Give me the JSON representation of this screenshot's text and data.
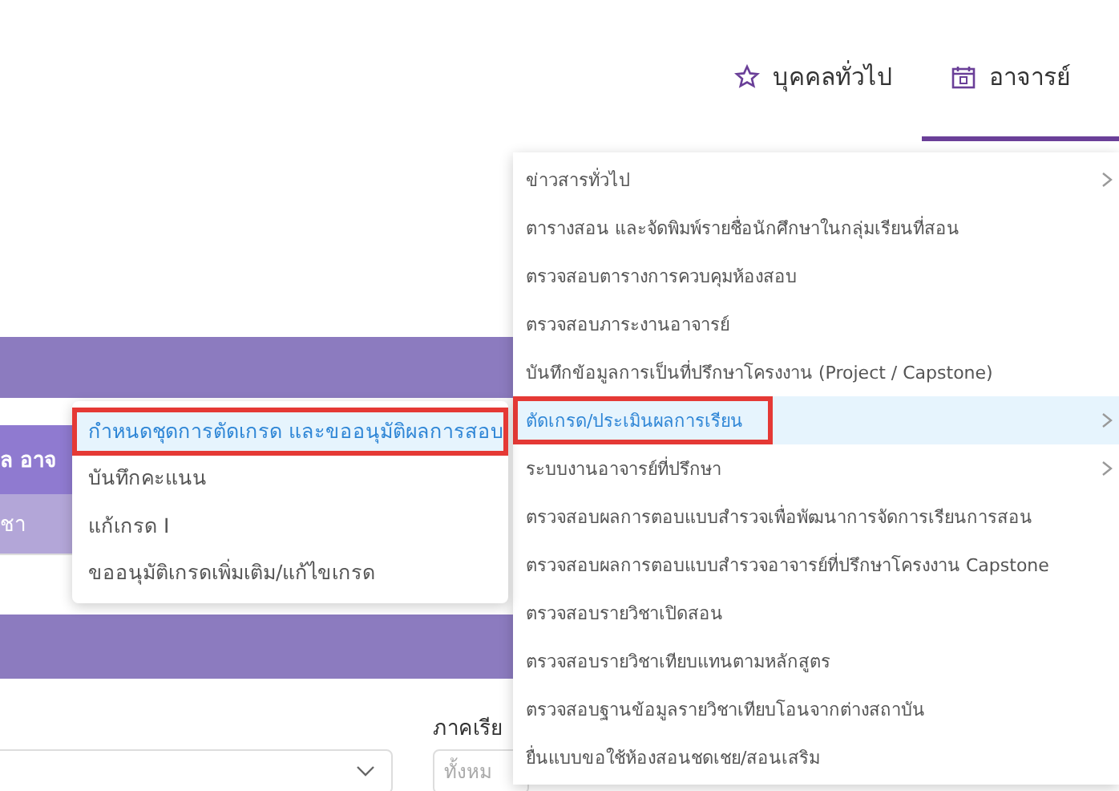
{
  "nav_tabs": [
    {
      "label": "บุคคลทั่วไป",
      "selected": false
    },
    {
      "label": "อาจารย์",
      "selected": true
    }
  ],
  "background": {
    "table_header": "ล อาจ",
    "table_row": "ชา",
    "filter_label": "ภาคเรีย",
    "filter_placeholder": "ทั้งหม"
  },
  "menu": {
    "items": [
      {
        "label": "ข่าวสารทั่วไป",
        "has_submenu": true,
        "selected": false,
        "highlighted": false
      },
      {
        "label": "ตารางสอน และจัดพิมพ์รายชื่อนักศึกษาในกลุ่มเรียนที่สอน",
        "has_submenu": false,
        "selected": false,
        "highlighted": false
      },
      {
        "label": "ตรวจสอบตารางการควบคุมห้องสอบ",
        "has_submenu": false,
        "selected": false,
        "highlighted": false
      },
      {
        "label": "ตรวจสอบภาระงานอาจารย์",
        "has_submenu": false,
        "selected": false,
        "highlighted": false
      },
      {
        "label": "บันทึกข้อมูลการเป็นที่ปรึกษาโครงงาน (Project / Capstone)",
        "has_submenu": false,
        "selected": false,
        "highlighted": false
      },
      {
        "label": "ตัดเกรด/ประเมินผลการเรียน",
        "has_submenu": true,
        "selected": true,
        "highlighted": true
      },
      {
        "label": "ระบบงานอาจารย์ที่ปรึกษา",
        "has_submenu": true,
        "selected": false,
        "highlighted": false
      },
      {
        "label": "ตรวจสอบผลการตอบแบบสำรวจเพื่อพัฒนาการจัดการเรียนการสอน",
        "has_submenu": false,
        "selected": false,
        "highlighted": false
      },
      {
        "label": "ตรวจสอบผลการตอบแบบสำรวจอาจารย์ที่ปรึกษาโครงงาน Capstone",
        "has_submenu": false,
        "selected": false,
        "highlighted": false
      },
      {
        "label": "ตรวจสอบรายวิชาเปิดสอน",
        "has_submenu": false,
        "selected": false,
        "highlighted": false
      },
      {
        "label": "ตรวจสอบรายวิชาเทียบแทนตามหลักสูตร",
        "has_submenu": false,
        "selected": false,
        "highlighted": false
      },
      {
        "label": "ตรวจสอบฐานข้อมูลรายวิชาเทียบโอนจากต่างสถาบัน",
        "has_submenu": false,
        "selected": false,
        "highlighted": false
      },
      {
        "label": "ยื่นแบบขอใช้ห้องสอนชดเชย/สอนเสริม",
        "has_submenu": false,
        "selected": false,
        "highlighted": false
      }
    ]
  },
  "submenu": {
    "items": [
      {
        "label": "กำหนดชุดการตัดเกรด และขออนุมัติผลการสอบ",
        "selected": true,
        "highlighted": true
      },
      {
        "label": "บันทึกคะแนน",
        "selected": false,
        "highlighted": false
      },
      {
        "label": "แก้เกรด I",
        "selected": false,
        "highlighted": false
      },
      {
        "label": "ขออนุมัติเกรดเพิ่มเติม/แก้ไขเกรด",
        "selected": false,
        "highlighted": false
      }
    ]
  }
}
